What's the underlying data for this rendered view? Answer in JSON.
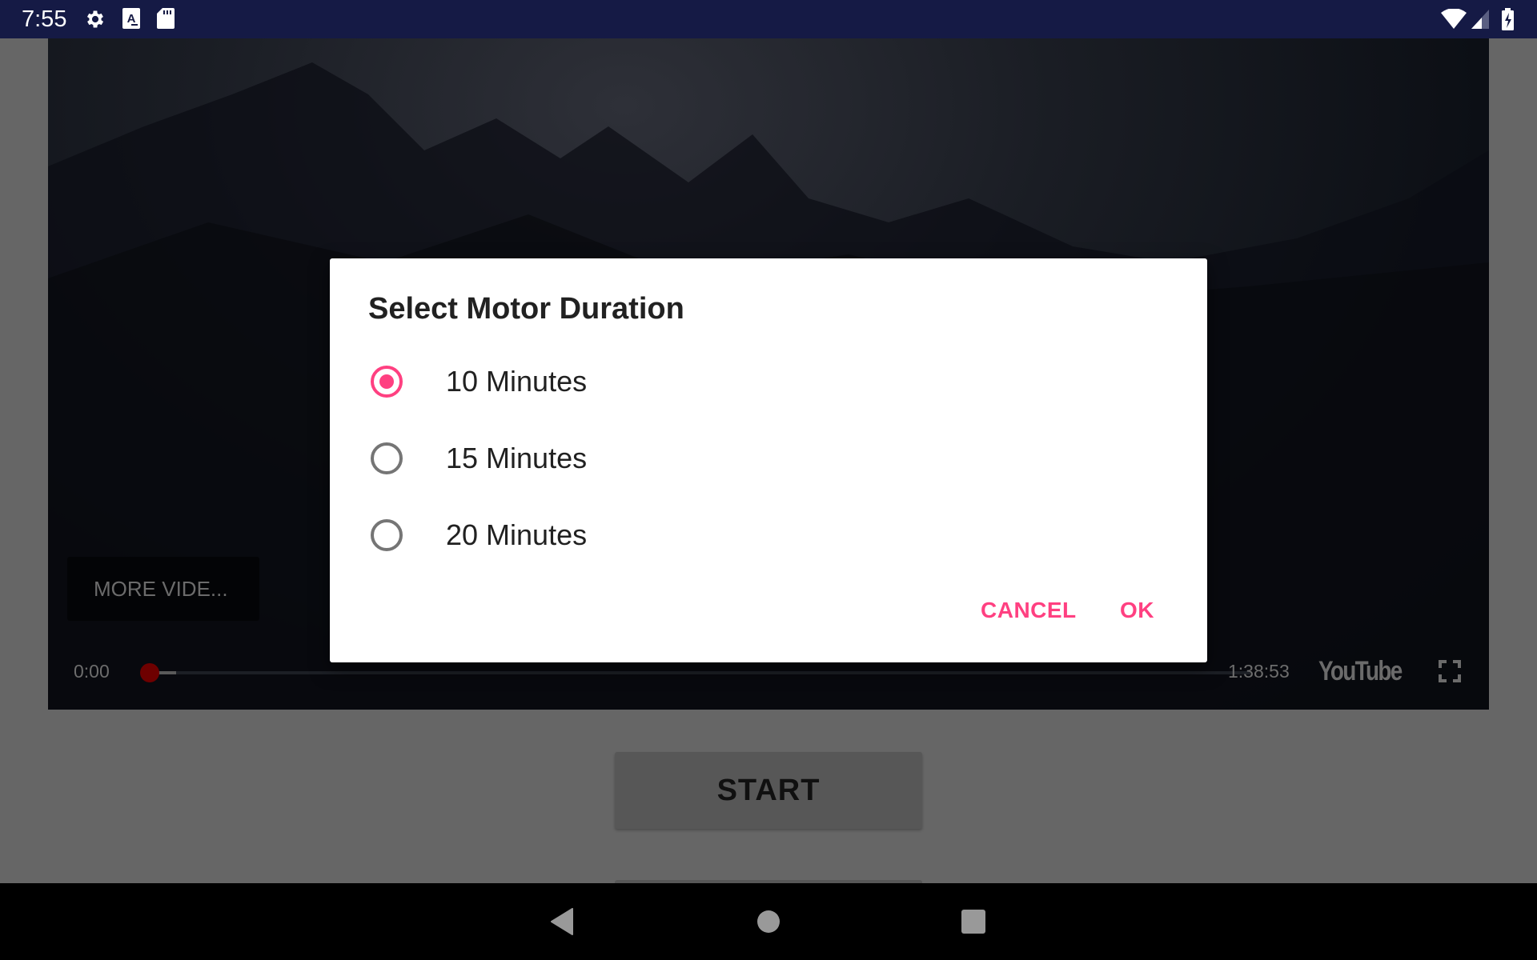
{
  "status_bar": {
    "time": "7:55",
    "left_icons": [
      "settings-icon",
      "font-a-icon",
      "sd-card-icon"
    ],
    "right_icons": [
      "wifi-icon",
      "cell-signal-icon",
      "battery-charging-icon"
    ]
  },
  "video_player": {
    "more_videos_label": "MORE VIDE...",
    "current_time": "0:00",
    "total_time": "1:38:53",
    "progress_fraction": 0.0,
    "brand_label": "YouTube",
    "fullscreen_icon": "fullscreen-icon"
  },
  "main": {
    "start_label": "START"
  },
  "dialog": {
    "title": "Select Motor Duration",
    "options": [
      {
        "label": "10 Minutes",
        "selected": true
      },
      {
        "label": "15 Minutes",
        "selected": false
      },
      {
        "label": "20 Minutes",
        "selected": false
      }
    ],
    "cancel_label": "CANCEL",
    "ok_label": "OK",
    "accent_color": "#ff4081"
  },
  "nav_bar": {
    "buttons": [
      "back-icon",
      "home-icon",
      "recents-icon"
    ]
  }
}
